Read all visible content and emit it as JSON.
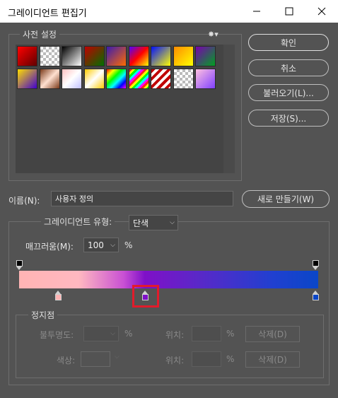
{
  "window": {
    "title": "그레이디언트 편집기"
  },
  "presets": {
    "title": "사전 설정",
    "swatches": [
      "linear-gradient(135deg,#ff0000,#600000)",
      "repeating-conic-gradient(#bbb 0% 25%,#fff 0% 50%) 0 0/8px 8px",
      "linear-gradient(135deg,#000,#fff)",
      "linear-gradient(135deg,#c00000,#007000)",
      "linear-gradient(135deg,#3a1cb0,#ff6a00)",
      "linear-gradient(135deg,#5000ff,#ff0000,#ffff00)",
      "linear-gradient(135deg,#0010ff,#ffff00)",
      "linear-gradient(135deg,#ff8c00,#ffff00)",
      "linear-gradient(135deg,#7a00b0,#00a020)",
      "linear-gradient(135deg,#ffde00,#4000d0)",
      "linear-gradient(135deg,#7a3a1a,#ffe0d0,#7a3a1a)",
      "linear-gradient(135deg,#ffc0c0,#fff,#c0c0ff)",
      "linear-gradient(135deg,#ffcc00,#fff,#ffcc00)",
      "linear-gradient(135deg,#ff0000,#ffff00,#00ff00,#00ffff,#0000ff,#ff00ff)",
      "repeating-linear-gradient(135deg,#ff2020 0 3px,#ffff00 3px 6px,#00ff00 6px 9px,#00ffff 9px 12px,#ff00ff 12px 15px)",
      "repeating-linear-gradient(135deg,#c00000 0 4px,#ffffff 4px 8px)",
      "repeating-conic-gradient(#bbb 0% 25%,#fff 0% 50%) 0 0/8px 8px",
      "linear-gradient(135deg,#ffc0e0,#8040ff)"
    ]
  },
  "buttons": {
    "ok": "확인",
    "cancel": "취소",
    "load": "불러오기(L)...",
    "save": "저장(S)...",
    "new": "새로 만들기(W)"
  },
  "name": {
    "label": "이름(N):",
    "value": "사용자 정의"
  },
  "gradient_type": {
    "label": "그레이디언트 유형:",
    "value": "단색"
  },
  "smoothness": {
    "label": "매끄러움(M):",
    "value": "100",
    "unit": "%"
  },
  "stops": {
    "title": "정지점",
    "opacity_label": "불투명도:",
    "opacity_unit": "%",
    "location_label": "위치:",
    "location_unit": "%",
    "delete_label": "삭제(D)",
    "color_label": "색상:"
  },
  "colors": {
    "highlight": "#e21b2b",
    "stop1": "#ffb4b4",
    "stop2": "#7f10c8",
    "stop3": "#0a46c8"
  }
}
